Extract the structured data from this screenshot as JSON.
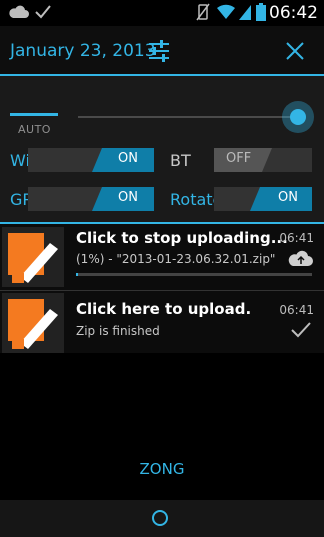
{
  "status_bar": {
    "left_icons": [
      "cloud-icon",
      "check-icon"
    ],
    "right_icons": [
      "no-vibrate-icon",
      "wifi-icon",
      "signal-icon",
      "battery-icon"
    ],
    "time": "06:42"
  },
  "header": {
    "date": "January 23, 2013",
    "settings_icon": "sliders-icon",
    "close_icon": "close-icon"
  },
  "quick_settings": {
    "brightness": {
      "label": "AUTO",
      "level": 1.0
    },
    "toggles": [
      {
        "label": "Wi-Fi",
        "state": "ON"
      },
      {
        "label": "BT",
        "state": "OFF"
      },
      {
        "label": "GPS",
        "state": "ON"
      },
      {
        "label": "Rotate",
        "state": "ON"
      }
    ]
  },
  "notifications": [
    {
      "title": "Click to stop uploading...",
      "time": "06:41",
      "subtitle": "(1%) - \"2013-01-23.06.32.01.zip\"",
      "progress": 0.01,
      "action_icon": "cloud-upload-icon"
    },
    {
      "title": "Click here to upload.",
      "time": "06:41",
      "subtitle": "Zip is finished",
      "action_icon": "check-icon"
    }
  ],
  "carrier": "ZONG",
  "colors": {
    "accent": "#33b5e5",
    "toggle_on": "#0f7ea8",
    "app_icon": "#f47a20"
  }
}
